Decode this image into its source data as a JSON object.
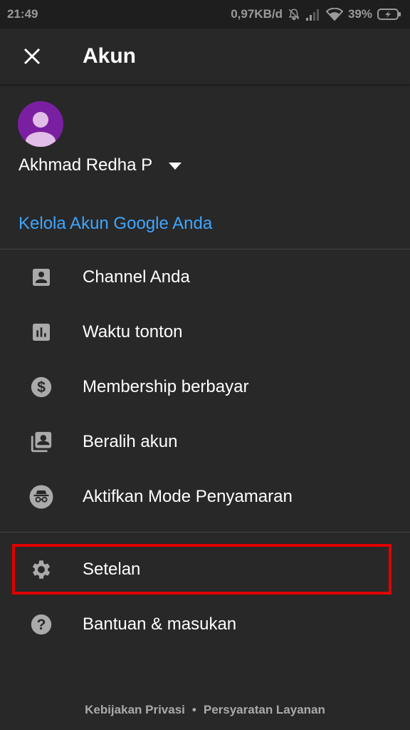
{
  "status_bar": {
    "time": "21:49",
    "network_speed": "0,97KB/d",
    "battery": "39%",
    "icons": [
      "mute-icon",
      "signal-icon",
      "wifi-icon",
      "battery-charging-icon"
    ]
  },
  "header": {
    "title": "Akun",
    "close_icon": "close-icon"
  },
  "account": {
    "avatar_color": "#7b1fa2",
    "name": "Akhmad Redha P",
    "manage_link": "Kelola Akun Google Anda"
  },
  "menu": {
    "items": [
      {
        "label": "Channel Anda",
        "icon": "account-box-icon"
      },
      {
        "label": "Waktu tonton",
        "icon": "bar-chart-icon"
      },
      {
        "label": "Membership berbayar",
        "icon": "dollar-icon"
      },
      {
        "label": "Beralih akun",
        "icon": "switch-account-icon"
      },
      {
        "label": "Aktifkan Mode Penyamaran",
        "icon": "incognito-icon"
      }
    ],
    "settings": {
      "label": "Setelan",
      "icon": "gear-icon"
    },
    "help": {
      "label": "Bantuan & masukan",
      "icon": "help-icon"
    }
  },
  "footer": {
    "privacy": "Kebijakan Privasi",
    "separator": "•",
    "terms": "Persyaratan Layanan"
  },
  "colors": {
    "background": "#282828",
    "link": "#3ea6ff",
    "highlight": "#e00000",
    "icon": "#aaaaaa"
  }
}
